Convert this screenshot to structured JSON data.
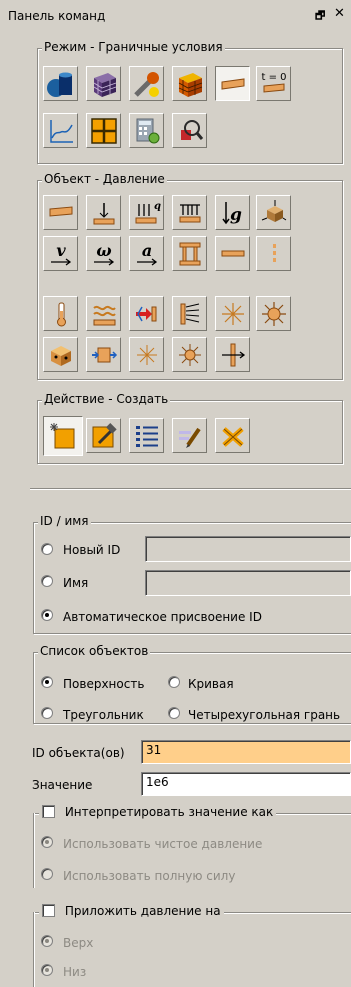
{
  "panel": {
    "title": "Панель команд",
    "restore_glyph": "🗗",
    "close_glyph": "✕"
  },
  "mode_group": {
    "title": "Режим - Граничные условия",
    "buttons": [
      {
        "name": "geometry-mode-icon"
      },
      {
        "name": "mesh-mode-icon"
      },
      {
        "name": "material-mode-icon"
      },
      {
        "name": "elements-mode-icon"
      },
      {
        "name": "boundary-conditions-mode-icon",
        "active": true
      },
      {
        "name": "initial-conditions-mode-icon",
        "text": "t = 0"
      },
      {
        "name": "load-curve-icon"
      },
      {
        "name": "grid-mode-icon"
      },
      {
        "name": "calculator-settings-icon"
      },
      {
        "name": "inspect-zoom-icon"
      }
    ]
  },
  "object_group": {
    "title": "Объект - Давление",
    "button_rows": [
      [
        "pressure-icon",
        "force-icon",
        "distributed-load-q-icon",
        "pressure-surface-icon",
        "gravity-g-icon",
        "rigid-body-icon"
      ],
      [
        "velocity-v-icon",
        "angular-velocity-omega-icon",
        "acceleration-a-icon",
        "column-support-icon",
        "beam-bc-icon",
        "dashed-bc-icon"
      ],
      [
        "temperature-icon",
        "convection-icon",
        "heat-flux-icon",
        "radiation-icon",
        "sparkle-source-icon",
        "sun-source-icon"
      ],
      [
        "contact-box-icon",
        "volume-flux-icon",
        "small-sparkle-icon",
        "small-sun-icon",
        "connector-arrow-icon"
      ]
    ]
  },
  "action_group": {
    "title": "Действие - Создать",
    "buttons": [
      {
        "name": "create-action-icon",
        "active": true
      },
      {
        "name": "modify-action-icon"
      },
      {
        "name": "list-action-icon"
      },
      {
        "name": "rename-action-icon"
      },
      {
        "name": "delete-action-icon"
      }
    ]
  },
  "id_group": {
    "title": "ID / имя",
    "new_id_label": "Новый ID",
    "name_label": "Имя",
    "auto_id_label": "Автоматическое присвоение ID",
    "selected": "auto"
  },
  "object_list_group": {
    "title": "Список объектов",
    "surface_label": "Поверхность",
    "curve_label": "Кривая",
    "triangle_label": "Треугольник",
    "quad_label": "Четырехугольная грань",
    "selected": "surface"
  },
  "object_ids": {
    "label": "ID объекта(ов)",
    "value": "31"
  },
  "value_field": {
    "label": "Значение",
    "value": "1e6"
  },
  "interpret_group": {
    "title": "Интерпретировать значение как",
    "checked": false,
    "pure_pressure_label": "Использовать чистое давление",
    "full_force_label": "Использовать полную силу"
  },
  "apply_group": {
    "title": "Приложить давление на",
    "checked": false,
    "top_label": "Верх",
    "bottom_label": "Низ"
  },
  "colors": {
    "panel_bg": "#d4d0c8",
    "ids_highlight": "#ffcf8a",
    "active_button_bg": "#f3f2ee",
    "disabled_text": "#8d8a83"
  }
}
